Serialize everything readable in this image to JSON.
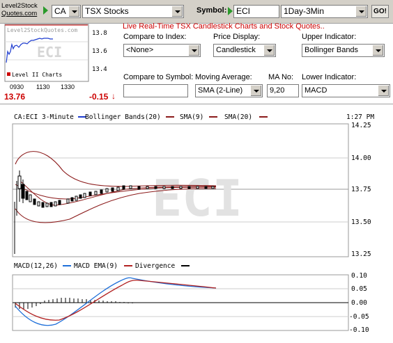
{
  "header": {
    "logo_line1": "Level2Stock",
    "logo_line2": "Quotes.com",
    "country": "CA",
    "exchange": "TSX Stocks",
    "symbol_label": "Symbol:",
    "symbol_value": "ECI",
    "interval": "1Day-3Min",
    "go_label": "GO!"
  },
  "mini_chart": {
    "watermark_site": "Level2StockQuotes.com",
    "watermark_symbol": "ECI",
    "legend": "Level II Charts",
    "y_ticks": [
      "13.8",
      "13.6",
      "13.4"
    ],
    "x_ticks": [
      "0930",
      "1130",
      "1330"
    ],
    "price": "13.76",
    "change": "-0.15"
  },
  "panel": {
    "live_title": "Live Real-Time TSX Candlestick Charts and Stock Quotes..",
    "compare_index_label": "Compare to Index:",
    "compare_index_value": "<None>",
    "price_display_label": "Price Display:",
    "price_display_value": "Candlestick",
    "upper_indicator_label": "Upper Indicator:",
    "upper_indicator_value": "Bollinger Bands",
    "compare_symbol_label": "Compare to Symbol:",
    "compare_symbol_value": "",
    "moving_average_label": "Moving Average:",
    "moving_average_value": "SMA (2-Line)",
    "ma_no_label": "MA No:",
    "ma_no_value": "9,20",
    "lower_indicator_label": "Lower Indicator:",
    "lower_indicator_value": "MACD"
  },
  "main_chart": {
    "header_symbol": "CA:ECI 3-Minute",
    "legend_bb": "Bollinger Bands(20)",
    "legend_sma9": "SMA(9)",
    "legend_sma20": "SMA(20)",
    "time": "1:27 PM",
    "watermark": "ECI",
    "y_ticks": [
      "14.25",
      "14.00",
      "13.75",
      "13.50",
      "13.25"
    ],
    "colors": {
      "bb": "#8b1a1a",
      "sma": "#8b1a1a",
      "candle": "#000000"
    }
  },
  "macd_chart": {
    "legend_macd": "MACD(12,26)",
    "legend_ema": "MACD EMA(9)",
    "legend_div": "Divergence",
    "y_ticks": [
      "0.10",
      "0.05",
      "0.00",
      "-0.05",
      "-0.10"
    ],
    "colors": {
      "macd": "#1e6fd9",
      "ema": "#b22222",
      "divergence": "#000000"
    }
  }
}
